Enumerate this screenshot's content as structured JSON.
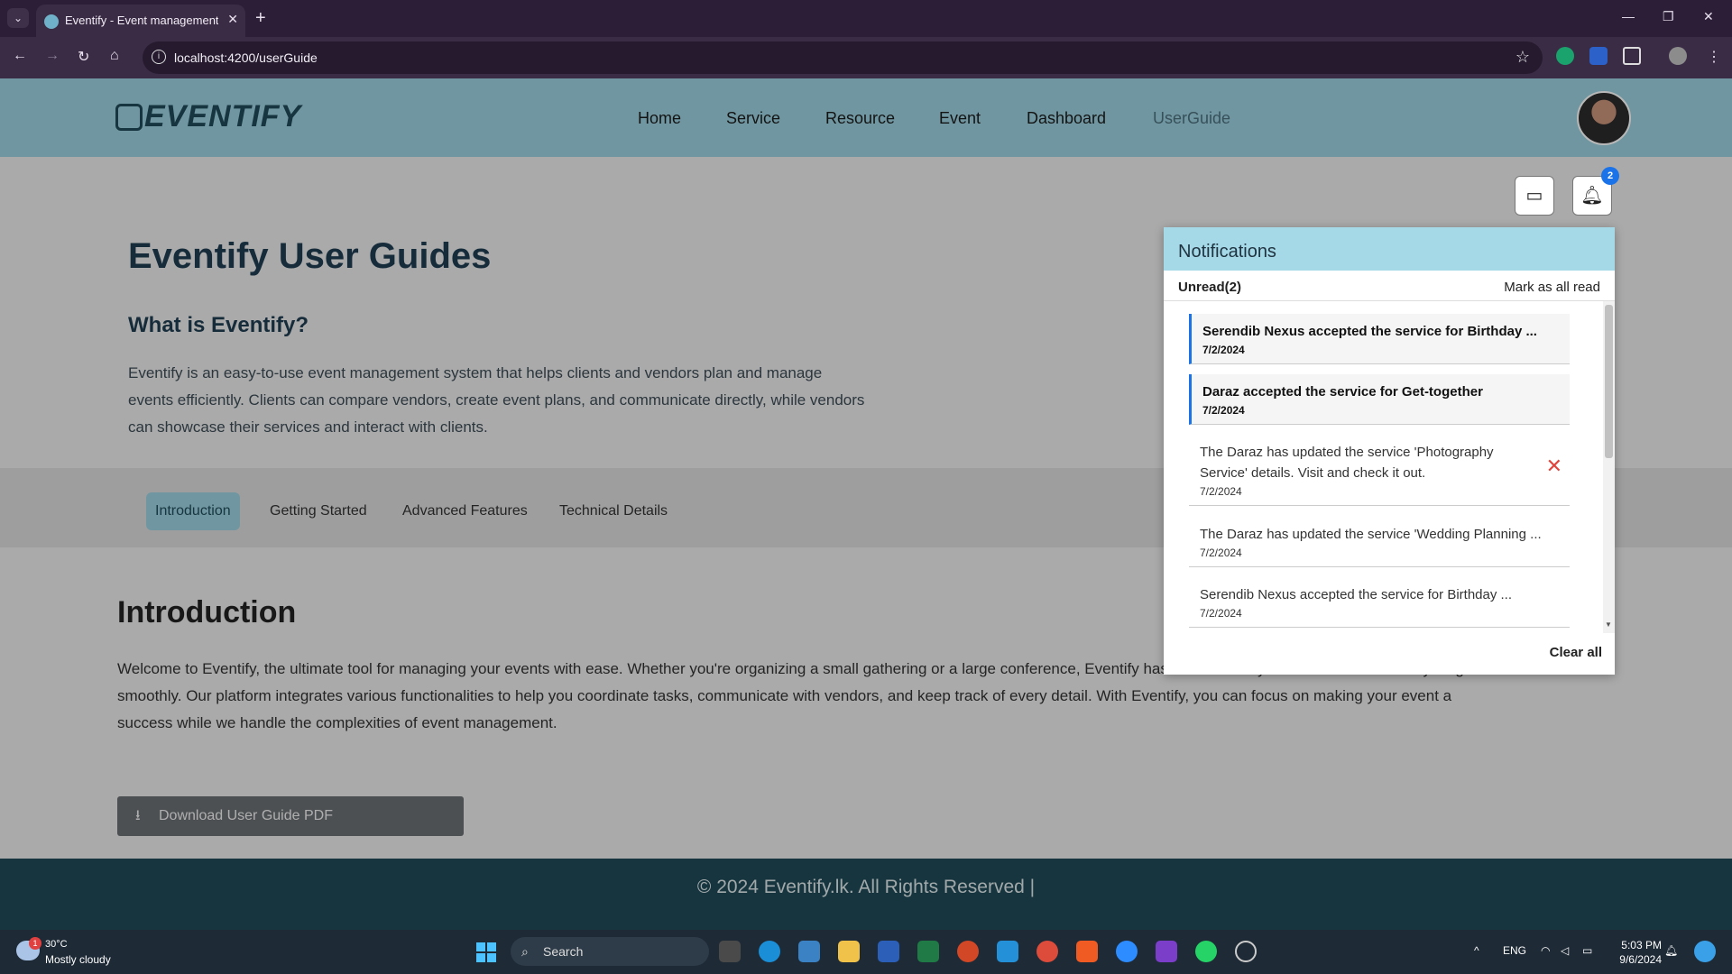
{
  "browser": {
    "tab_title": "Eventify - Event management s",
    "url": "localhost:4200/userGuide"
  },
  "site": {
    "logo_text": "EVENTIFY",
    "nav": [
      "Home",
      "Service",
      "Resource",
      "Event",
      "Dashboard",
      "UserGuide"
    ],
    "active_nav": "UserGuide"
  },
  "hero": {
    "title": "Eventify User Guides",
    "subtitle": "What is Eventify?",
    "text": "Eventify is an easy-to-use event management system that helps clients and vendors plan and manage events efficiently. Clients can compare vendors, create event plans, and communicate directly, while vendors can showcase their services and interact with clients."
  },
  "guide_tabs": [
    "Introduction",
    "Getting Started",
    "Advanced Features",
    "Technical Details"
  ],
  "active_guide_tab": "Introduction",
  "section": {
    "title": "Introduction",
    "text": "Welcome to Eventify, the ultimate tool for managing your events with ease. Whether you're organizing a small gathering or a large conference, Eventify has the features you need to ensure everything runs smoothly. Our platform integrates various functionalities to help you coordinate tasks, communicate with vendors, and keep track of every detail. With Eventify, you can focus on making your event a success while we handle the complexities of event management."
  },
  "download_button": "Download User Guide PDF",
  "footer": "© 2024 Eventify.lk. All Rights Reserved |",
  "notifications": {
    "badge_count": "2",
    "title": "Notifications",
    "unread_label": "Unread(2)",
    "mark_all_read": "Mark as all read",
    "clear_all": "Clear all",
    "items": [
      {
        "text": "Serendib Nexus accepted the service for Birthday ...",
        "date": "7/2/2024",
        "unread": true
      },
      {
        "text": "Daraz accepted the service for Get-together",
        "date": "7/2/2024",
        "unread": true
      },
      {
        "text": "The Daraz has updated the service 'Photography Service' details. Visit and check it out.",
        "date": "7/2/2024",
        "unread": false
      },
      {
        "text": "The Daraz has updated the service 'Wedding Planning ...",
        "date": "7/2/2024",
        "unread": false
      },
      {
        "text": "Serendib Nexus accepted the service for Birthday ...",
        "date": "7/2/2024",
        "unread": false
      }
    ]
  },
  "taskbar": {
    "weather_temp": "30°C",
    "weather_condition": "Mostly cloudy",
    "weather_badge": "1",
    "search_placeholder": "Search",
    "language": "ENG",
    "time": "5:03 PM",
    "date": "9/6/2024"
  }
}
